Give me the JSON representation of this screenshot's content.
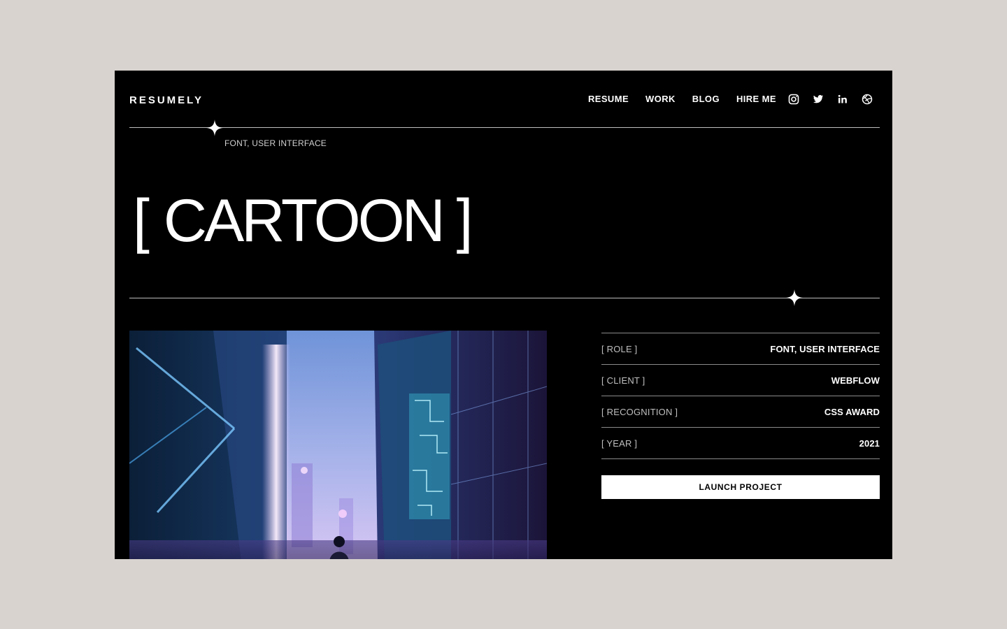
{
  "brand": {
    "logo": "RESUMELY"
  },
  "nav": {
    "items": [
      "RESUME",
      "WORK",
      "BLOG",
      "HIRE ME"
    ],
    "social": [
      "instagram-icon",
      "twitter-icon",
      "linkedin-icon",
      "dribbble-icon"
    ]
  },
  "project": {
    "subtitle": "FONT, USER INTERFACE",
    "title_open": "[",
    "title": "CARTOON",
    "title_close": "]"
  },
  "details": [
    {
      "label": "[ ROLE ]",
      "value": "FONT, USER INTERFACE"
    },
    {
      "label": "[ CLIENT ]",
      "value": "WEBFLOW"
    },
    {
      "label": "[ RECOGNITION ]",
      "value": "CSS AWARD"
    },
    {
      "label": "[ YEAR ]",
      "value": "2021"
    }
  ],
  "cta": {
    "launch_label": "LAUNCH PROJECT"
  },
  "colors": {
    "page_bg": "#d8d3cf",
    "frame_bg": "#000000",
    "text": "#ffffff",
    "button_bg": "#ffffff"
  }
}
